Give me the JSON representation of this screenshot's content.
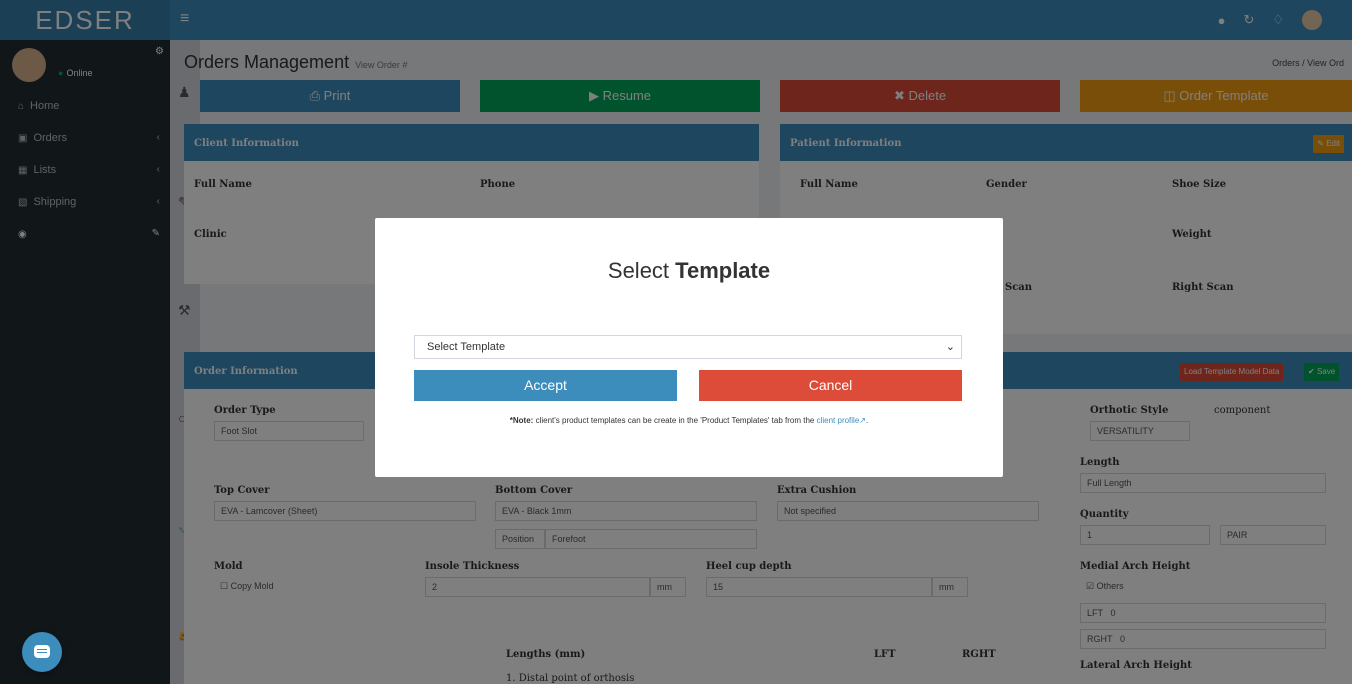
{
  "app": {
    "logo": "EDSER"
  },
  "navbar": {
    "menu_icon": "≡",
    "icons": [
      "user-icon",
      "refresh-icon",
      "bell-icon"
    ]
  },
  "sidebar": {
    "user_status": "Online",
    "items": [
      {
        "label": "Home",
        "icon": "home-icon"
      },
      {
        "label": "Orders",
        "icon": "cart-icon"
      },
      {
        "label": "Lists",
        "icon": "list-icon"
      },
      {
        "label": "Shipping",
        "icon": "truck-icon"
      },
      {
        "label": "",
        "icon": "settings-icon"
      }
    ]
  },
  "page": {
    "title": "Orders Management",
    "subtitle": "View Order #",
    "breadcrumb": "Orders / View Ord"
  },
  "actions": {
    "print": "Print",
    "resume": "Resume",
    "delete": "Delete",
    "order_template": "Order Template"
  },
  "client_info": {
    "heading": "Client Information",
    "full_name_label": "Full Name",
    "phone_label": "Phone",
    "clinic_label": "Clinic"
  },
  "patient_info": {
    "heading": "Patient Information",
    "full_name_label": "Full Name",
    "gender_label": "Gender",
    "shoe_size_label": "Shoe Size",
    "weight_label": "Weight",
    "scan_label": "Scan",
    "right_scan_label": "Right Scan",
    "edit_label": "Edit"
  },
  "order_info": {
    "heading": "Order Information",
    "order_type_label": "Order Type",
    "order_type_value": "Foot Slot",
    "orthotic_style_label": "Orthotic Style",
    "orthotic_style_value": "VERSATILITY",
    "component_alt": "component",
    "length_label": "Length",
    "length_value": "Full Length",
    "top_cover_label": "Top Cover",
    "top_cover_value": "EVA - Lamcover (Sheet)",
    "bottom_cover_label": "Bottom Cover",
    "bottom_cover_value": "EVA - Black 1mm",
    "extra_cushion_label": "Extra Cushion",
    "extra_cushion_value": "Not specified",
    "quantity_label": "Quantity",
    "quantity_value": "1",
    "quantity_unit": "PAIR",
    "position_label": "Position",
    "position_value": "Forefoot",
    "mold_label": "Mold",
    "copy_mold_label": "Copy Mold",
    "insole_thickness_label": "Insole Thickness",
    "insole_thickness_value": "2",
    "heel_cup_label": "Heel cup depth",
    "heel_cup_value": "15",
    "mm": "mm",
    "medial_arch_label": "Medial Arch Height",
    "others_label": "Others",
    "lft": "LFT",
    "rght": "RGHT",
    "zero": "0",
    "lateral_arch_label": "Lateral Arch Height",
    "lengths_label": "Lengths (mm)",
    "distal_label": "1. Distal point of orthosis",
    "load_template_label": "Load Template Model Data",
    "save_label": "Save"
  },
  "modal": {
    "title_prefix": "Select ",
    "title_bold": "Template",
    "select_value": "Select Template",
    "accept": "Accept",
    "cancel": "Cancel",
    "note_prefix": "*Note:",
    "note_text": " client's product templates can be create in the 'Product Templates' tab from the ",
    "note_link": "client profile"
  },
  "colors": {
    "primary": "#3c8dbc",
    "success": "#00a65a",
    "danger": "#dd4b39",
    "warning": "#f39c12",
    "sidebar": "#222d32"
  }
}
